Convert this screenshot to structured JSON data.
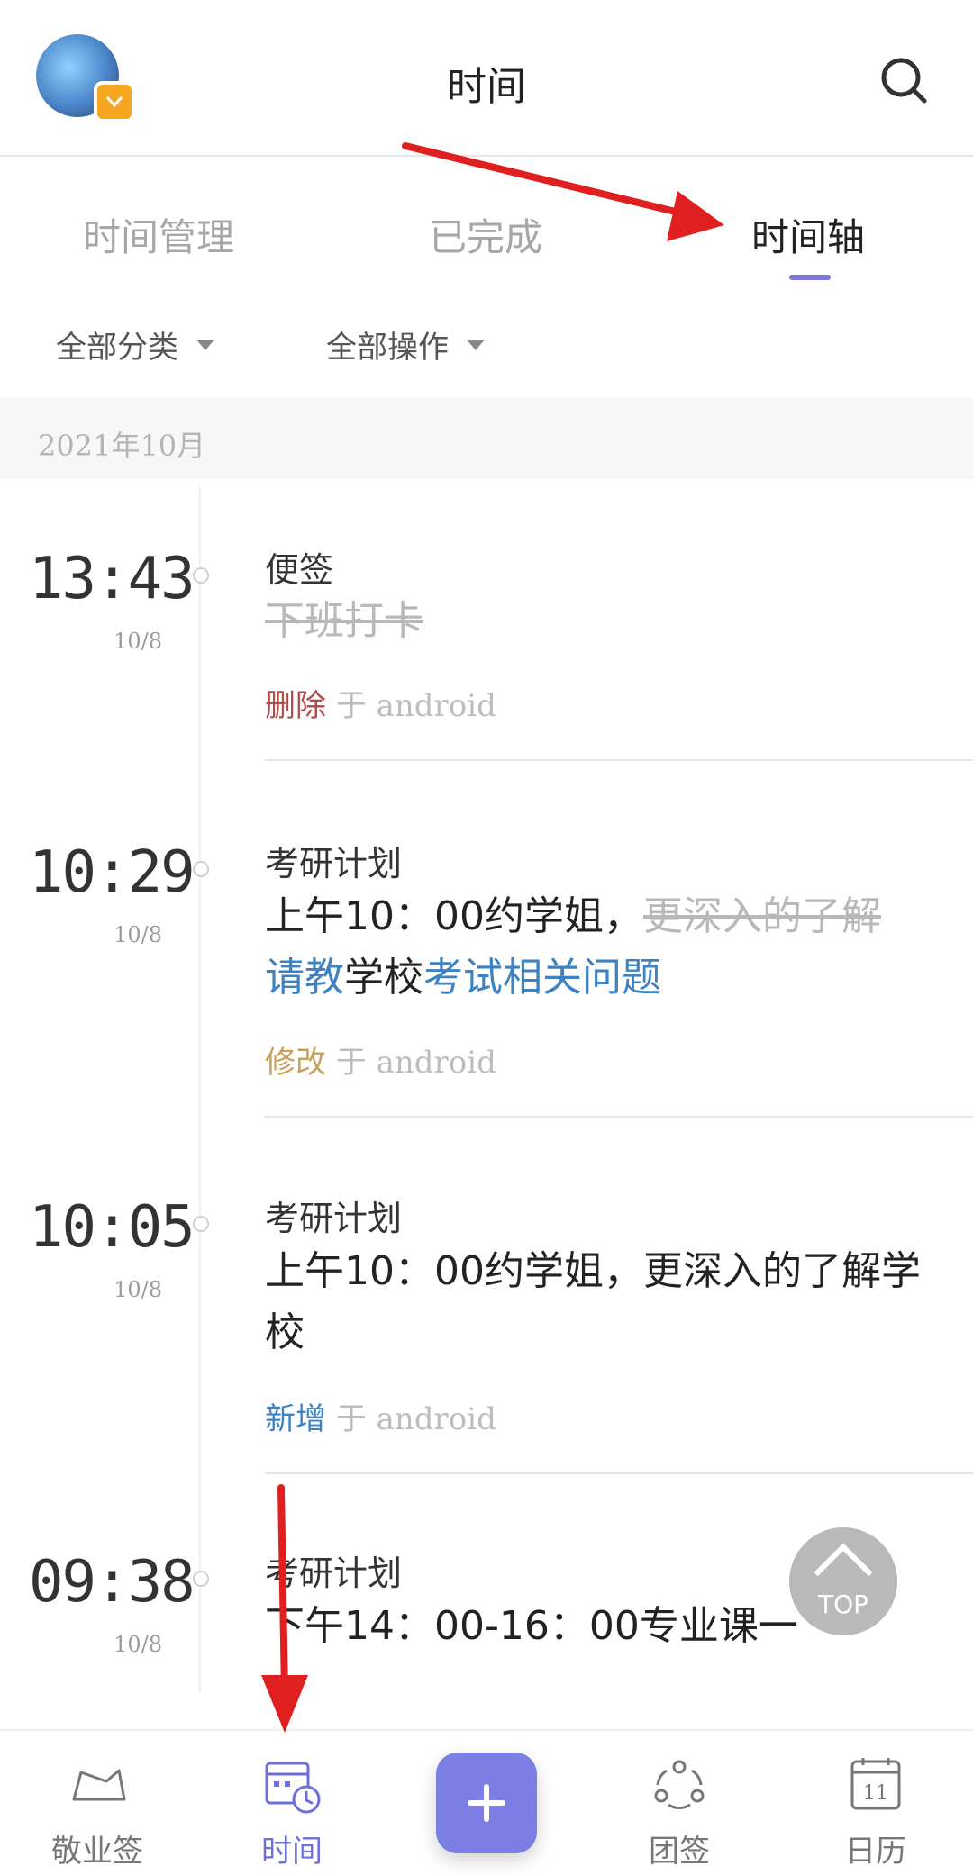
{
  "header": {
    "title": "时间",
    "avatar_badge_icon": "chevron-down-icon",
    "search_icon": "search-icon"
  },
  "tabs": [
    {
      "label": "时间管理",
      "active": false
    },
    {
      "label": "已完成",
      "active": false
    },
    {
      "label": "时间轴",
      "active": true
    }
  ],
  "filters": {
    "category": "全部分类",
    "operation": "全部操作"
  },
  "month_label": "2021年10月",
  "entries": [
    {
      "time": "13:43",
      "date": "10/8",
      "category": "便签",
      "text_strike": "下班打卡",
      "status": "删除",
      "via": "于 android"
    },
    {
      "time": "10:29",
      "date": "10/8",
      "category": "考研计划",
      "text_part1": "上午10：00约学姐，",
      "text_part2_strike": "更深入的了解",
      "text_part3_blue": "请教",
      "text_part4": "学校",
      "text_part5_blue": "考试相关问题",
      "status": "修改",
      "via": "于 android"
    },
    {
      "time": "10:05",
      "date": "10/8",
      "category": "考研计划",
      "text": "上午10：00约学姐，更深入的了解学校",
      "status": "新增",
      "via": "于 android"
    },
    {
      "time": "09:38",
      "date": "10/8",
      "category": "考研计划",
      "text": "下午14：00-16：00专业课一"
    }
  ],
  "top_button": {
    "label": "TOP"
  },
  "bottom_nav": [
    {
      "label": "敬业签",
      "icon": "note-icon",
      "active": false
    },
    {
      "label": "时间",
      "icon": "calendar-clock-icon",
      "active": true
    },
    {
      "label": "",
      "icon": "plus-icon",
      "active": false
    },
    {
      "label": "团签",
      "icon": "group-icon",
      "active": false
    },
    {
      "label": "日历",
      "icon": "calendar-icon",
      "active": false,
      "day": "11"
    }
  ],
  "colors": {
    "accent": "#7b7ee3",
    "tab_indicator": "#7c7bd3",
    "delete": "#b24a4a",
    "modify": "#c6a15a",
    "add": "#3d82c3",
    "annotation_arrow": "#e02020"
  }
}
